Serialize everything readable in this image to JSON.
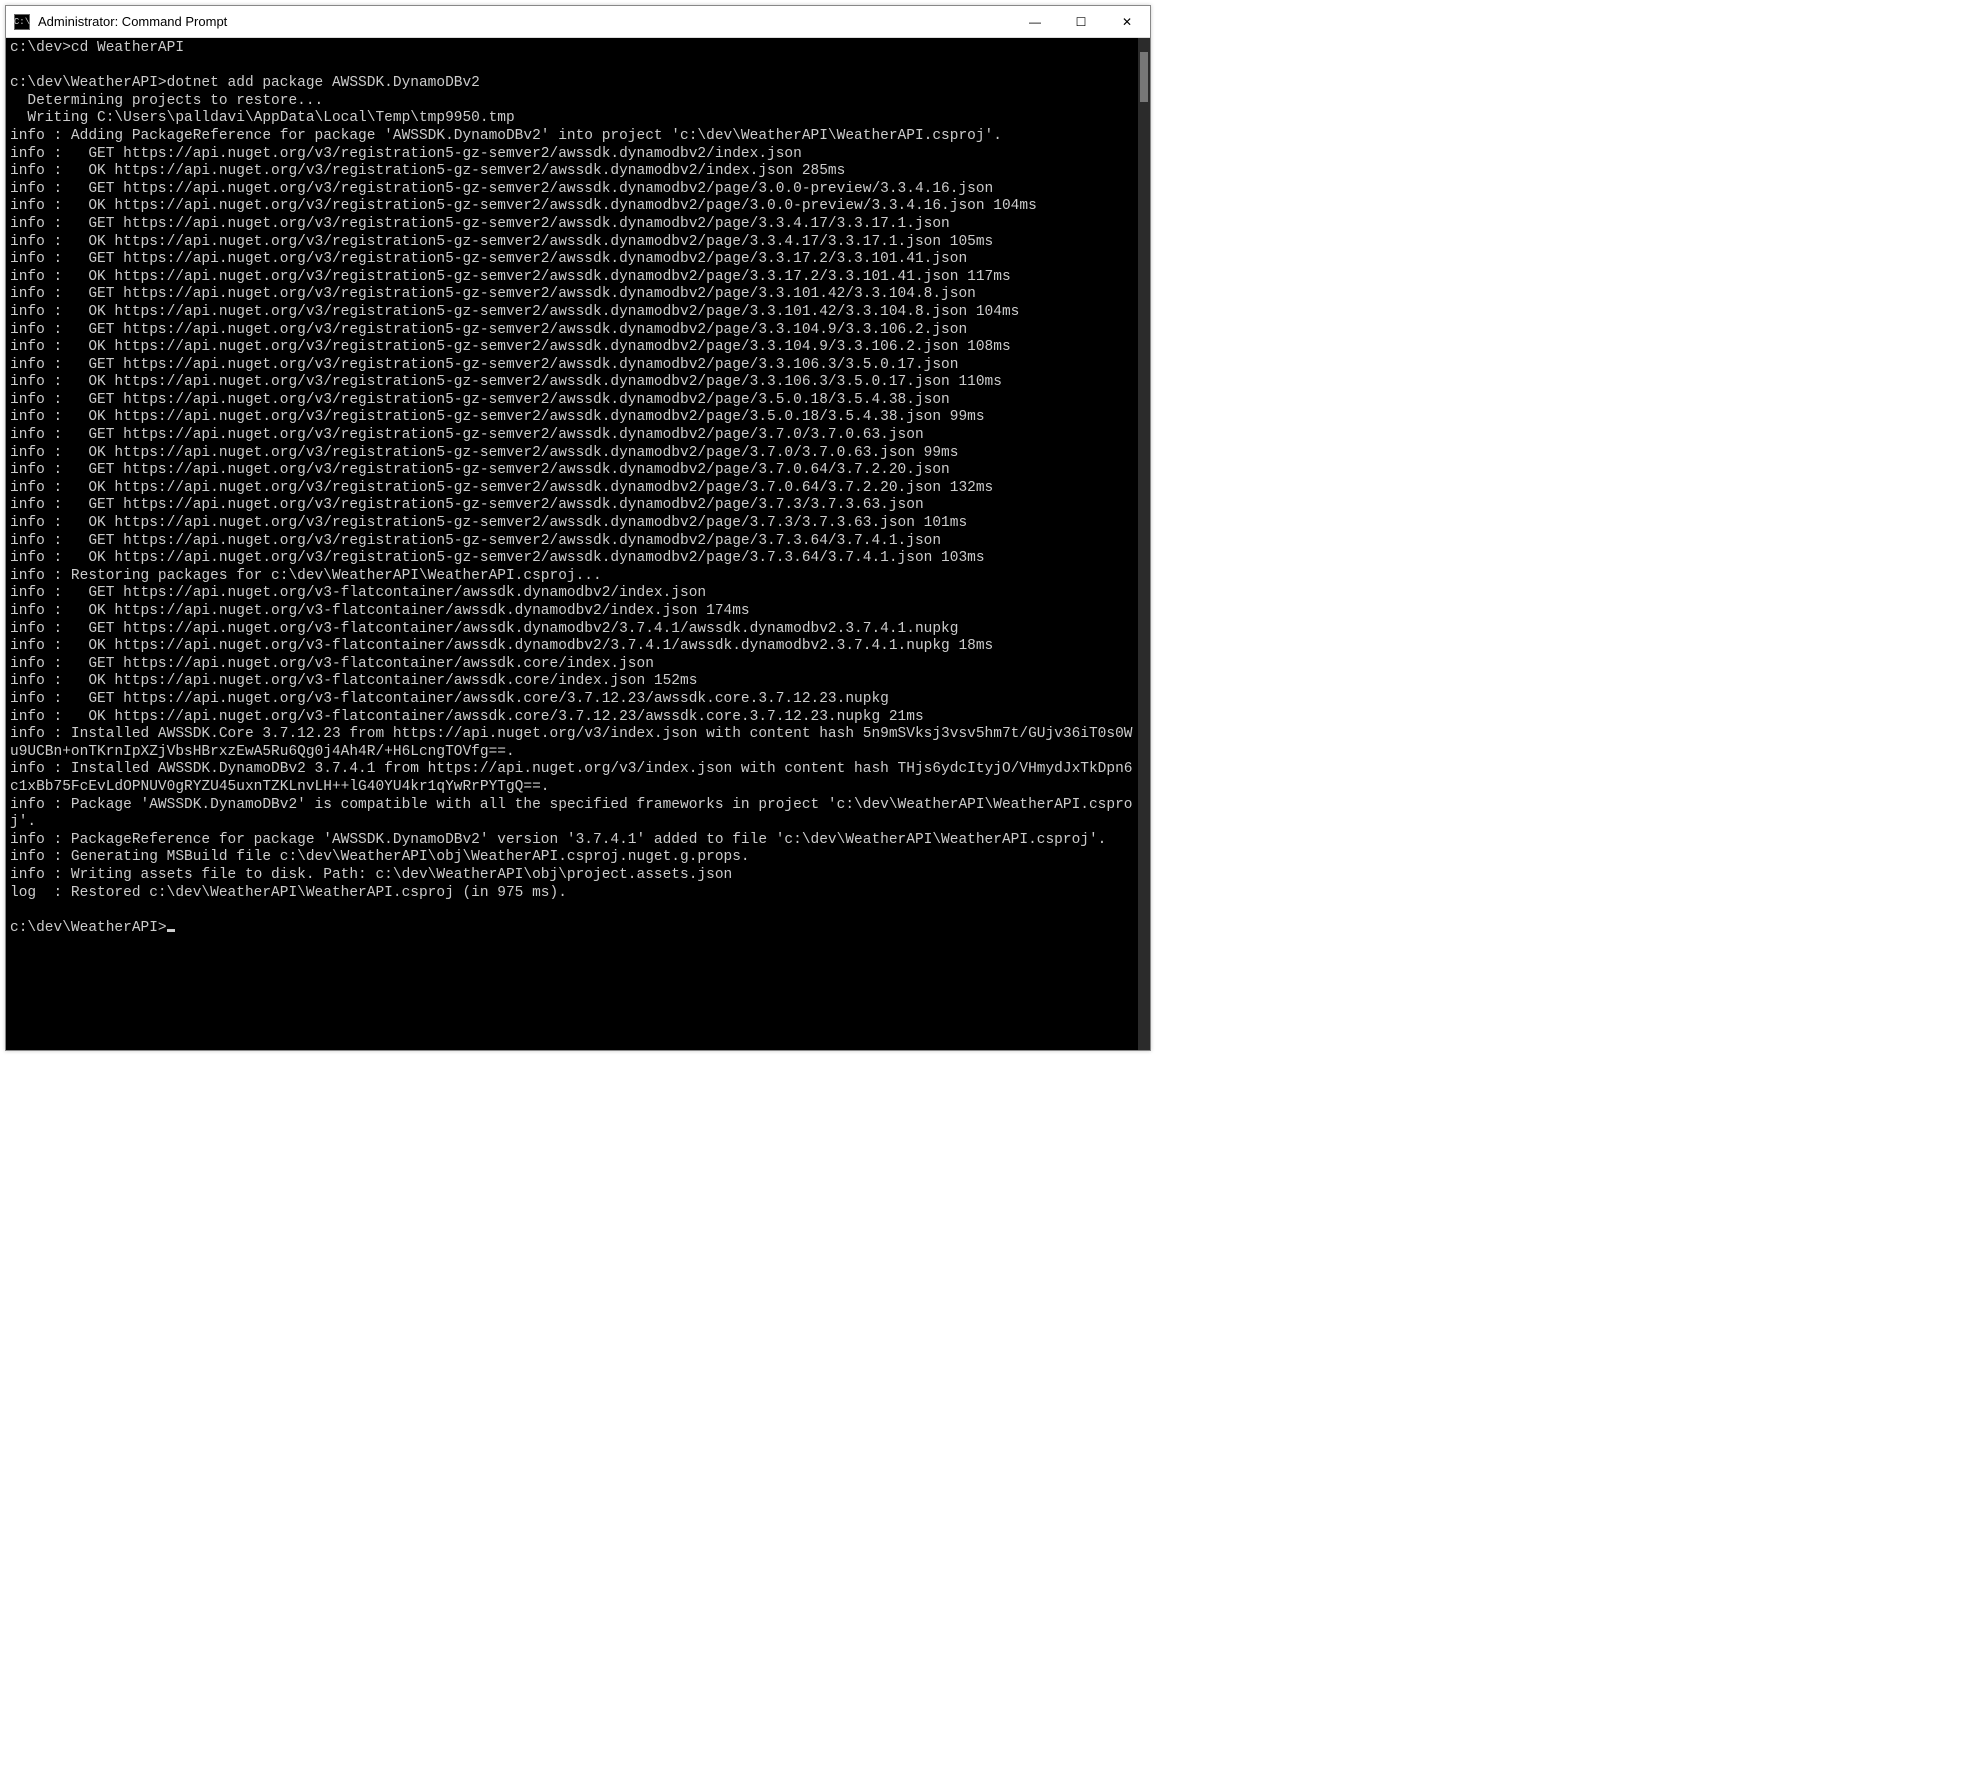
{
  "window": {
    "title": "Administrator: Command Prompt",
    "icon_glyph": "C:\\"
  },
  "titlebar_buttons": {
    "minimize": "—",
    "maximize": "☐",
    "close": "✕"
  },
  "terminal": {
    "lines": [
      "c:\\dev>cd WeatherAPI",
      "",
      "c:\\dev\\WeatherAPI>dotnet add package AWSSDK.DynamoDBv2",
      "  Determining projects to restore...",
      "  Writing C:\\Users\\palldavi\\AppData\\Local\\Temp\\tmp9950.tmp",
      "info : Adding PackageReference for package 'AWSSDK.DynamoDBv2' into project 'c:\\dev\\WeatherAPI\\WeatherAPI.csproj'.",
      "info :   GET https://api.nuget.org/v3/registration5-gz-semver2/awssdk.dynamodbv2/index.json",
      "info :   OK https://api.nuget.org/v3/registration5-gz-semver2/awssdk.dynamodbv2/index.json 285ms",
      "info :   GET https://api.nuget.org/v3/registration5-gz-semver2/awssdk.dynamodbv2/page/3.0.0-preview/3.3.4.16.json",
      "info :   OK https://api.nuget.org/v3/registration5-gz-semver2/awssdk.dynamodbv2/page/3.0.0-preview/3.3.4.16.json 104ms",
      "info :   GET https://api.nuget.org/v3/registration5-gz-semver2/awssdk.dynamodbv2/page/3.3.4.17/3.3.17.1.json",
      "info :   OK https://api.nuget.org/v3/registration5-gz-semver2/awssdk.dynamodbv2/page/3.3.4.17/3.3.17.1.json 105ms",
      "info :   GET https://api.nuget.org/v3/registration5-gz-semver2/awssdk.dynamodbv2/page/3.3.17.2/3.3.101.41.json",
      "info :   OK https://api.nuget.org/v3/registration5-gz-semver2/awssdk.dynamodbv2/page/3.3.17.2/3.3.101.41.json 117ms",
      "info :   GET https://api.nuget.org/v3/registration5-gz-semver2/awssdk.dynamodbv2/page/3.3.101.42/3.3.104.8.json",
      "info :   OK https://api.nuget.org/v3/registration5-gz-semver2/awssdk.dynamodbv2/page/3.3.101.42/3.3.104.8.json 104ms",
      "info :   GET https://api.nuget.org/v3/registration5-gz-semver2/awssdk.dynamodbv2/page/3.3.104.9/3.3.106.2.json",
      "info :   OK https://api.nuget.org/v3/registration5-gz-semver2/awssdk.dynamodbv2/page/3.3.104.9/3.3.106.2.json 108ms",
      "info :   GET https://api.nuget.org/v3/registration5-gz-semver2/awssdk.dynamodbv2/page/3.3.106.3/3.5.0.17.json",
      "info :   OK https://api.nuget.org/v3/registration5-gz-semver2/awssdk.dynamodbv2/page/3.3.106.3/3.5.0.17.json 110ms",
      "info :   GET https://api.nuget.org/v3/registration5-gz-semver2/awssdk.dynamodbv2/page/3.5.0.18/3.5.4.38.json",
      "info :   OK https://api.nuget.org/v3/registration5-gz-semver2/awssdk.dynamodbv2/page/3.5.0.18/3.5.4.38.json 99ms",
      "info :   GET https://api.nuget.org/v3/registration5-gz-semver2/awssdk.dynamodbv2/page/3.7.0/3.7.0.63.json",
      "info :   OK https://api.nuget.org/v3/registration5-gz-semver2/awssdk.dynamodbv2/page/3.7.0/3.7.0.63.json 99ms",
      "info :   GET https://api.nuget.org/v3/registration5-gz-semver2/awssdk.dynamodbv2/page/3.7.0.64/3.7.2.20.json",
      "info :   OK https://api.nuget.org/v3/registration5-gz-semver2/awssdk.dynamodbv2/page/3.7.0.64/3.7.2.20.json 132ms",
      "info :   GET https://api.nuget.org/v3/registration5-gz-semver2/awssdk.dynamodbv2/page/3.7.3/3.7.3.63.json",
      "info :   OK https://api.nuget.org/v3/registration5-gz-semver2/awssdk.dynamodbv2/page/3.7.3/3.7.3.63.json 101ms",
      "info :   GET https://api.nuget.org/v3/registration5-gz-semver2/awssdk.dynamodbv2/page/3.7.3.64/3.7.4.1.json",
      "info :   OK https://api.nuget.org/v3/registration5-gz-semver2/awssdk.dynamodbv2/page/3.7.3.64/3.7.4.1.json 103ms",
      "info : Restoring packages for c:\\dev\\WeatherAPI\\WeatherAPI.csproj...",
      "info :   GET https://api.nuget.org/v3-flatcontainer/awssdk.dynamodbv2/index.json",
      "info :   OK https://api.nuget.org/v3-flatcontainer/awssdk.dynamodbv2/index.json 174ms",
      "info :   GET https://api.nuget.org/v3-flatcontainer/awssdk.dynamodbv2/3.7.4.1/awssdk.dynamodbv2.3.7.4.1.nupkg",
      "info :   OK https://api.nuget.org/v3-flatcontainer/awssdk.dynamodbv2/3.7.4.1/awssdk.dynamodbv2.3.7.4.1.nupkg 18ms",
      "info :   GET https://api.nuget.org/v3-flatcontainer/awssdk.core/index.json",
      "info :   OK https://api.nuget.org/v3-flatcontainer/awssdk.core/index.json 152ms",
      "info :   GET https://api.nuget.org/v3-flatcontainer/awssdk.core/3.7.12.23/awssdk.core.3.7.12.23.nupkg",
      "info :   OK https://api.nuget.org/v3-flatcontainer/awssdk.core/3.7.12.23/awssdk.core.3.7.12.23.nupkg 21ms",
      "info : Installed AWSSDK.Core 3.7.12.23 from https://api.nuget.org/v3/index.json with content hash 5n9mSVksj3vsv5hm7t/GUjv36iT0s0Wu9UCBn+onTKrnIpXZjVbsHBrxzEwA5Ru6Qg0j4Ah4R/+H6LcngTOVfg==.",
      "info : Installed AWSSDK.DynamoDBv2 3.7.4.1 from https://api.nuget.org/v3/index.json with content hash THjs6ydcItyjO/VHmydJxTkDpn6c1xBb75FcEvLdOPNUV0gRYZU45uxnTZKLnvLH++lG40YU4kr1qYwRrPYTgQ==.",
      "info : Package 'AWSSDK.DynamoDBv2' is compatible with all the specified frameworks in project 'c:\\dev\\WeatherAPI\\WeatherAPI.csproj'.",
      "info : PackageReference for package 'AWSSDK.DynamoDBv2' version '3.7.4.1' added to file 'c:\\dev\\WeatherAPI\\WeatherAPI.csproj'.",
      "info : Generating MSBuild file c:\\dev\\WeatherAPI\\obj\\WeatherAPI.csproj.nuget.g.props.",
      "info : Writing assets file to disk. Path: c:\\dev\\WeatherAPI\\obj\\project.assets.json",
      "log  : Restored c:\\dev\\WeatherAPI\\WeatherAPI.csproj (in 975 ms).",
      ""
    ],
    "prompt": "c:\\dev\\WeatherAPI>"
  }
}
